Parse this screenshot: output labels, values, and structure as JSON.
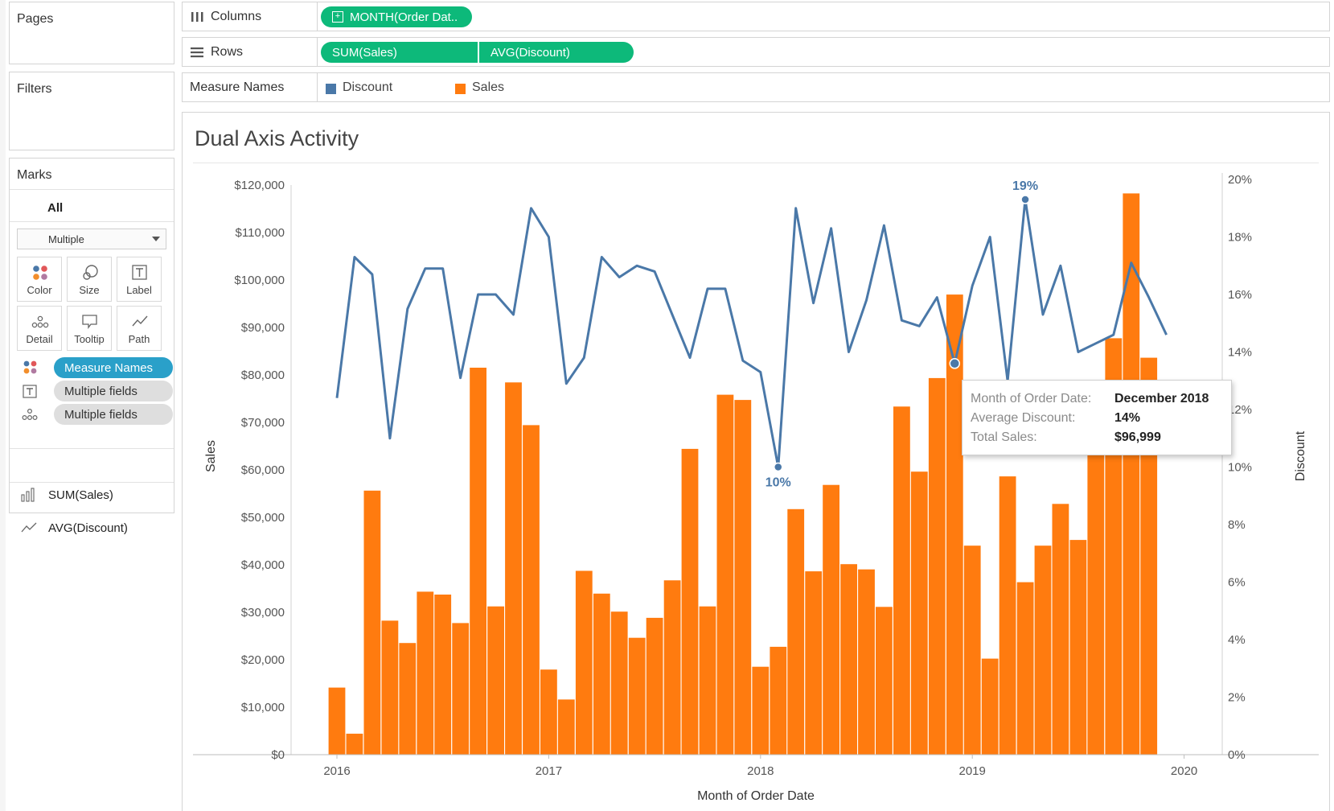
{
  "sidebar": {
    "pages_title": "Pages",
    "filters_title": "Filters",
    "marks_title": "Marks",
    "marks_all": "All",
    "mark_type": "Multiple",
    "buttons": {
      "color": "Color",
      "size": "Size",
      "label": "Label",
      "detail": "Detail",
      "tooltip": "Tooltip",
      "path": "Path"
    },
    "pills": {
      "color_field": "Measure Names",
      "label_field": "Multiple fields",
      "detail_field": "Multiple fields"
    },
    "measures": {
      "sum_sales": "SUM(Sales)",
      "avg_discount": "AVG(Discount)"
    }
  },
  "shelves": {
    "columns_label": "Columns",
    "columns_pill": "MONTH(Order Dat..",
    "rows_label": "Rows",
    "rows_pill_1": "SUM(Sales)",
    "rows_pill_2": "AVG(Discount)",
    "legend_label": "Measure Names",
    "legend_discount": "Discount",
    "legend_sales": "Sales"
  },
  "colors": {
    "sales": "#ff7b0f",
    "discount": "#4a78a8",
    "pill_green": "#0db97a",
    "pill_blue": "#2aa0c9",
    "pill_gray": "#dedede"
  },
  "tooltip": {
    "k1": "Month of Order Date:",
    "v1": "December 2018",
    "k2": "Average Discount:",
    "v2": "14%",
    "k3": "Total Sales:",
    "v3": "$96,999"
  },
  "chart_data": {
    "type": "bar",
    "title": "Dual Axis Activity",
    "xlabel": "Month of Order Date",
    "ylabel": "Sales",
    "y2label": "Discount",
    "ylim": [
      0,
      120000
    ],
    "y2lim": [
      0,
      20
    ],
    "y_ticks": [
      "$0",
      "$10,000",
      "$20,000",
      "$30,000",
      "$40,000",
      "$50,000",
      "$60,000",
      "$70,000",
      "$80,000",
      "$90,000",
      "$100,000",
      "$110,000",
      "$120,000"
    ],
    "y2_ticks": [
      "0%",
      "2%",
      "4%",
      "6%",
      "8%",
      "10%",
      "12%",
      "14%",
      "16%",
      "18%",
      "20%"
    ],
    "x_ticks": [
      "2016",
      "2017",
      "2018",
      "2019",
      "2020"
    ],
    "grid": false,
    "legend": "top",
    "series": [
      {
        "name": "Sales",
        "mark": "bar",
        "values": [
          14200,
          4500,
          55700,
          28300,
          23600,
          34400,
          33800,
          27800,
          81600,
          31300,
          78500,
          69500,
          18000,
          11700,
          38800,
          34000,
          30200,
          24700,
          28900,
          36800,
          64500,
          31300,
          75900,
          74800,
          18600,
          22800,
          51800,
          38700,
          56900,
          40200,
          39100,
          31200,
          73400,
          59700,
          79400,
          96999,
          44100,
          20300,
          58700,
          36400,
          44100,
          52900,
          45300,
          69000,
          87800,
          118300,
          83700
        ]
      },
      {
        "name": "Discount",
        "mark": "line",
        "values": [
          12.4,
          17.3,
          16.7,
          11.0,
          15.5,
          16.9,
          16.9,
          13.1,
          16.0,
          16.0,
          15.3,
          19.0,
          18.0,
          12.9,
          13.8,
          17.3,
          16.6,
          17.0,
          16.8,
          15.3,
          13.8,
          16.2,
          16.2,
          13.7,
          13.3,
          10.0,
          19.0,
          15.7,
          18.3,
          14.0,
          15.8,
          18.4,
          15.1,
          14.9,
          15.9,
          13.6,
          16.3,
          18.0,
          13.0,
          19.3,
          15.3,
          17.0,
          14.0,
          14.3,
          14.6,
          17.1,
          15.9,
          14.6
        ]
      }
    ],
    "annotations": [
      {
        "series": "Discount",
        "month": "2018-01",
        "text": "10%"
      },
      {
        "series": "Discount",
        "month": "2019-04",
        "text": "19%"
      }
    ]
  }
}
